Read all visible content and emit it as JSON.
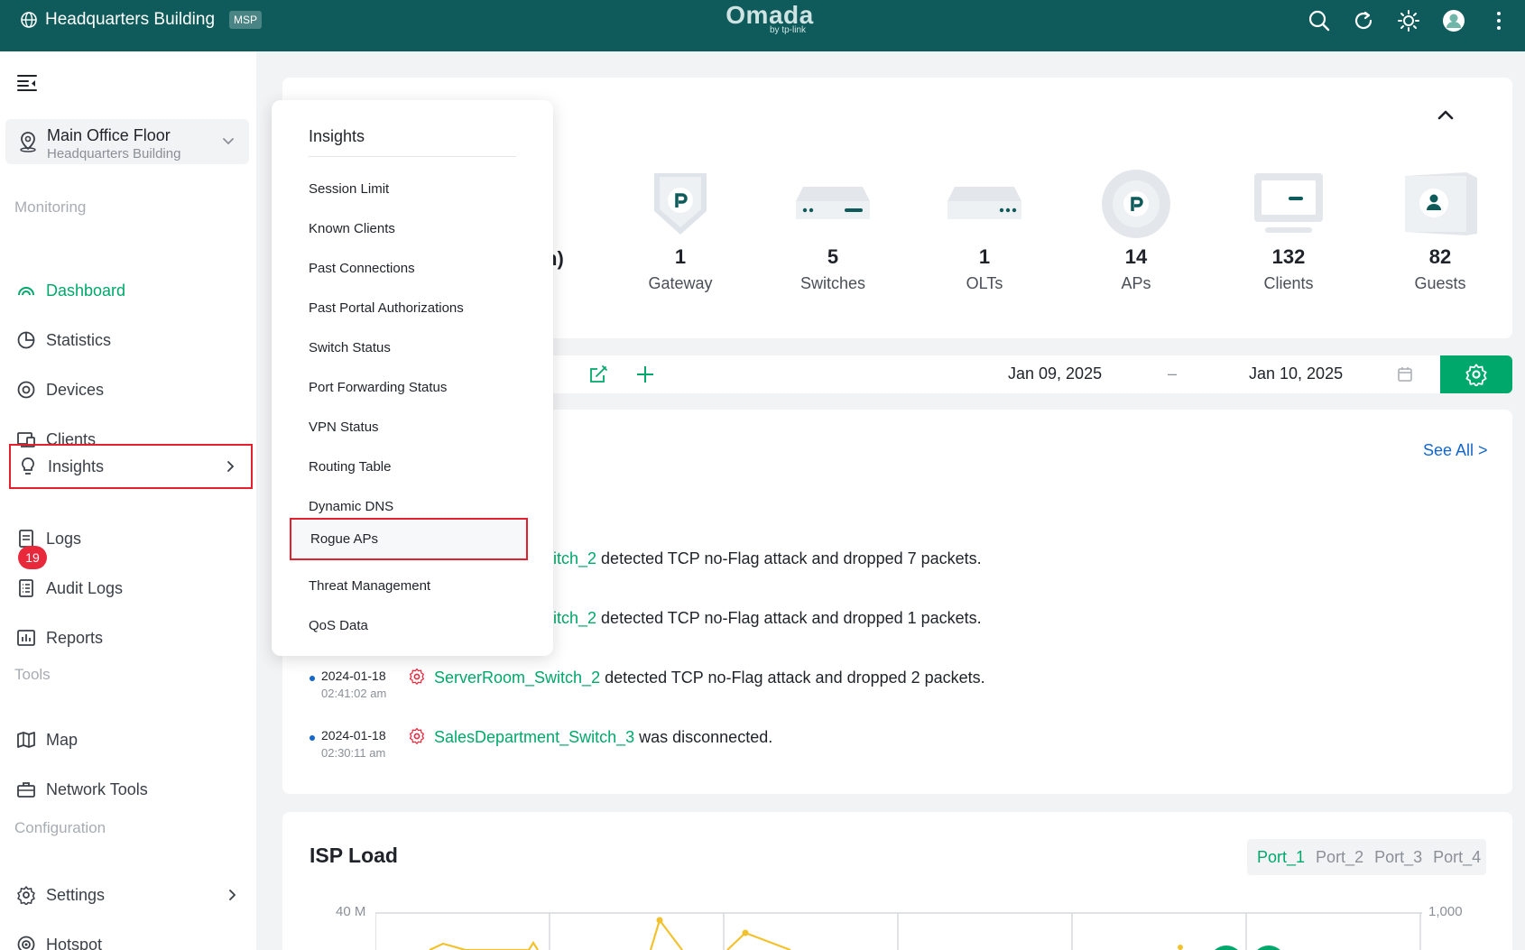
{
  "topbar": {
    "site_name": "Headquarters Building",
    "msp_badge": "MSP",
    "brand": "Omada",
    "brand_sub": "by tp-link",
    "icons": [
      "search-icon",
      "refresh-icon",
      "theme-sun-icon",
      "user-avatar",
      "more-vertical-icon"
    ]
  },
  "sidebar": {
    "site_selector": {
      "name": "Main Office Floor",
      "parent": "Headquarters Building"
    },
    "monitoring_label": "Monitoring",
    "monitoring_items": [
      {
        "label": "Dashboard",
        "icon": "dashboard-icon",
        "active": true
      },
      {
        "label": "Statistics",
        "icon": "pie-chart-icon"
      },
      {
        "label": "Devices",
        "icon": "devices-icon"
      },
      {
        "label": "Clients",
        "icon": "clients-icon"
      },
      {
        "label": "Insights",
        "icon": "lightbulb-icon",
        "has_submenu": true,
        "highlighted": true
      },
      {
        "label": "Logs",
        "icon": "logs-icon",
        "badge": "19"
      },
      {
        "label": "Audit Logs",
        "icon": "audit-logs-icon"
      },
      {
        "label": "Reports",
        "icon": "reports-icon"
      }
    ],
    "tools_label": "Tools",
    "tools_items": [
      {
        "label": "Map",
        "icon": "map-icon"
      },
      {
        "label": "Network Tools",
        "icon": "toolbox-icon"
      }
    ],
    "config_label": "Configuration",
    "config_items": [
      {
        "label": "Settings",
        "icon": "gear-icon",
        "has_submenu": true
      },
      {
        "label": "Hotspot",
        "icon": "hotspot-icon"
      }
    ]
  },
  "overview": {
    "partial_text": "n)",
    "devices": [
      {
        "count": "1",
        "label": "Gateway",
        "icon": "gateway-icon"
      },
      {
        "count": "5",
        "label": "Switches",
        "icon": "switch-icon"
      },
      {
        "count": "1",
        "label": "OLTs",
        "icon": "olt-icon"
      },
      {
        "count": "14",
        "label": "APs",
        "icon": "access-point-icon"
      },
      {
        "count": "132",
        "label": "Clients",
        "icon": "monitor-icon"
      },
      {
        "count": "82",
        "label": "Guests",
        "icon": "guest-icon"
      }
    ]
  },
  "date_range": {
    "start": "Jan 09, 2025",
    "separator": "–",
    "end": "Jan 10, 2025"
  },
  "logs": {
    "see_all": "See All >",
    "rows": [
      {
        "date": "",
        "time": "",
        "device": "itch_2",
        "message": " detected TCP no-Flag attack and dropped 7 packets."
      },
      {
        "date": "",
        "time": "",
        "device": "itch_2",
        "message": " detected TCP no-Flag attack and dropped 1 packets."
      },
      {
        "date": "2024-01-18",
        "time": "02:41:02 am",
        "device": "ServerRoom_Switch_2",
        "message": " detected TCP no-Flag attack and dropped 2 packets."
      },
      {
        "date": "2024-01-18",
        "time": "02:30:11 am",
        "device": "SalesDepartment_Switch_3",
        "message": " was disconnected."
      }
    ]
  },
  "isp_load": {
    "title": "ISP Load",
    "ports": [
      "Port_1",
      "Port_2",
      "Port_3",
      "Port_4"
    ],
    "active_port": "Port_1",
    "y_left_top": "40 M",
    "y_right_top": "1,000"
  },
  "insights_menu": {
    "title": "Insights",
    "items": [
      "Session Limit",
      "Known Clients",
      "Past Connections",
      "Past Portal Authorizations",
      "Switch Status",
      "Port Forwarding Status",
      "VPN Status",
      "Routing Table",
      "Dynamic DNS",
      "Rogue APs",
      "Threat Management",
      "QoS Data"
    ],
    "highlighted": "Rogue APs"
  },
  "colors": {
    "topbar": "#0f5b5b",
    "accent_green": "#00a86b",
    "link_blue": "#1466c8",
    "alert_red": "#e5202e"
  }
}
